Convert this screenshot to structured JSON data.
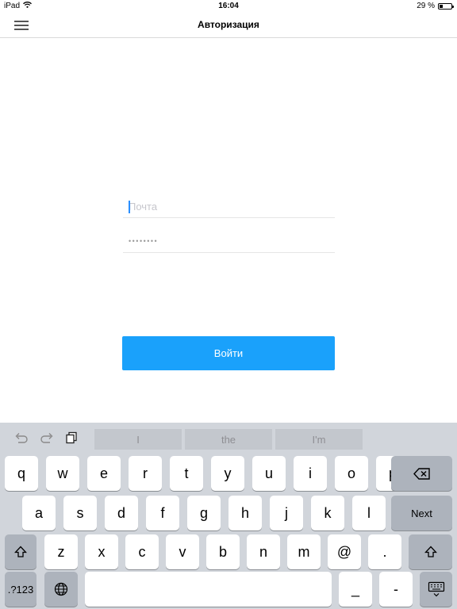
{
  "status_bar": {
    "device": "iPad",
    "time": "16:04",
    "battery_text": "29 %",
    "battery_level": 0.29
  },
  "nav": {
    "title": "Авторизация",
    "menu_icon": "hamburger-icon"
  },
  "form": {
    "email_placeholder": "Почта",
    "email_value": "",
    "password_mask": "••••••••",
    "login_label": "Войти",
    "accent": "#1aa1fb"
  },
  "keyboard": {
    "suggestions": [
      "I",
      "the",
      "I'm"
    ],
    "row1": [
      "q",
      "w",
      "e",
      "r",
      "t",
      "y",
      "u",
      "i",
      "o",
      "p"
    ],
    "row2": [
      "a",
      "s",
      "d",
      "f",
      "g",
      "h",
      "j",
      "k",
      "l"
    ],
    "row3": [
      "z",
      "x",
      "c",
      "v",
      "b",
      "n",
      "m",
      "@",
      "."
    ],
    "next_label": "Next",
    "numbers_label": ".?123",
    "underscore": "_",
    "dash": "-",
    "icons": [
      "undo-icon",
      "redo-icon",
      "paste-icon",
      "backspace-icon",
      "shift-icon",
      "globe-icon",
      "keyboard-dismiss-icon"
    ]
  }
}
